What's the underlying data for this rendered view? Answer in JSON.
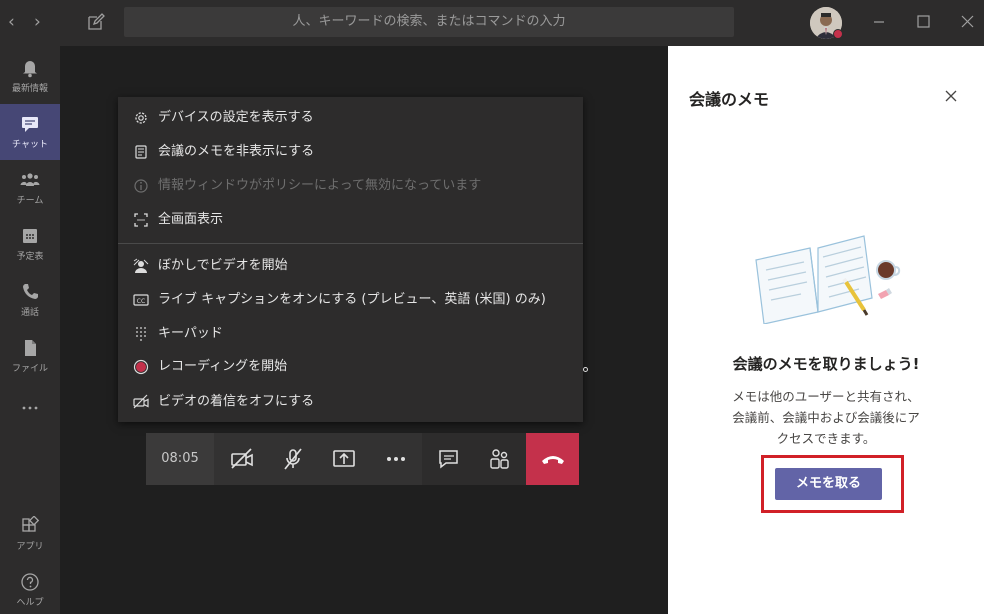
{
  "titlebar": {
    "search_placeholder": "人、キーワードの検索、またはコマンドの入力"
  },
  "rail": {
    "items": [
      {
        "label": "最新情報",
        "icon": "bell-icon"
      },
      {
        "label": "チャット",
        "icon": "chat-icon",
        "active": true
      },
      {
        "label": "チーム",
        "icon": "teams-icon"
      },
      {
        "label": "予定表",
        "icon": "calendar-icon"
      },
      {
        "label": "通話",
        "icon": "phone-icon"
      },
      {
        "label": "ファイル",
        "icon": "file-icon"
      },
      {
        "label": "アプリ",
        "icon": "apps-icon"
      },
      {
        "label": "ヘルプ",
        "icon": "help-icon"
      }
    ]
  },
  "menu": {
    "items": [
      {
        "label": "デバイスの設定を表示する",
        "icon": "gear-icon"
      },
      {
        "label": "会議のメモを非表示にする",
        "icon": "notes-icon"
      },
      {
        "label": "情報ウィンドウがポリシーによって無効になっています",
        "icon": "info-icon",
        "disabled": true
      },
      {
        "label": "全画面表示",
        "icon": "fullscreen-icon"
      },
      {
        "label": "ぼかしでビデオを開始",
        "icon": "blur-icon"
      },
      {
        "label": "ライブ キャプションをオンにする (プレビュー、英語 (米国) のみ)",
        "icon": "cc-icon"
      },
      {
        "label": "キーパッド",
        "icon": "keypad-icon"
      },
      {
        "label": "レコーディングを開始",
        "icon": "record-icon"
      },
      {
        "label": "ビデオの着信をオフにする",
        "icon": "video-off-icon"
      }
    ]
  },
  "controls": {
    "timer": "08:05"
  },
  "panel": {
    "title": "会議のメモ",
    "heading": "会議のメモを取りましょう!",
    "desc_lines": [
      "メモは他のユーザーと共有され、",
      "会議前、会議中および会議後にア",
      "クセスできます。"
    ],
    "button_label": "メモを取る"
  },
  "colors": {
    "accent": "#6264a7",
    "hangup": "#c4314b",
    "highlight": "#d12027"
  }
}
